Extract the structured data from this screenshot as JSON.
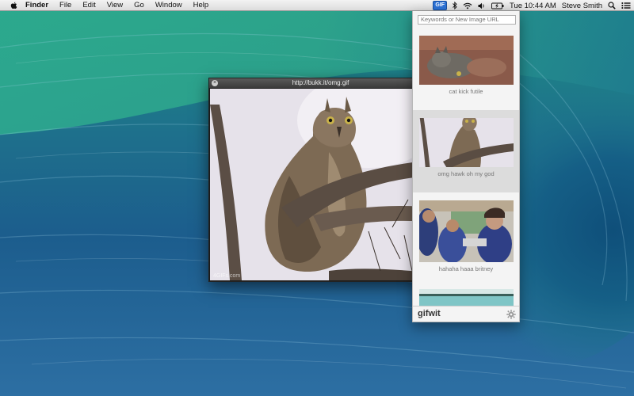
{
  "menubar": {
    "app_name": "Finder",
    "items": [
      "File",
      "Edit",
      "View",
      "Go",
      "Window",
      "Help"
    ],
    "status": {
      "gif_badge": "GIF",
      "clock": "Tue 10:44 AM",
      "username": "Steve Smith"
    },
    "icons": [
      "apple-icon",
      "gif-menu-icon",
      "bluetooth-icon",
      "wifi-icon",
      "volume-icon",
      "battery-icon",
      "spotlight-search-icon",
      "notification-center-icon"
    ]
  },
  "viewer": {
    "title": "http://bukk.it/omg.gif",
    "watermark": "4GIFs.com"
  },
  "gifwit": {
    "search_placeholder": "Keywords or New Image URL",
    "results": [
      {
        "caption": "cat kick futile",
        "selected": false
      },
      {
        "caption": "omg hawk oh my god",
        "selected": true
      },
      {
        "caption": "hahaha haaa britney",
        "selected": false
      },
      {
        "caption": "",
        "selected": false
      }
    ],
    "brand": "gifwit"
  },
  "colors": {
    "selection": "#dcdcdc",
    "menubar": "#e8e8e8",
    "wave_deep": "#1c5f8a",
    "wave_light": "#2aa38c"
  }
}
